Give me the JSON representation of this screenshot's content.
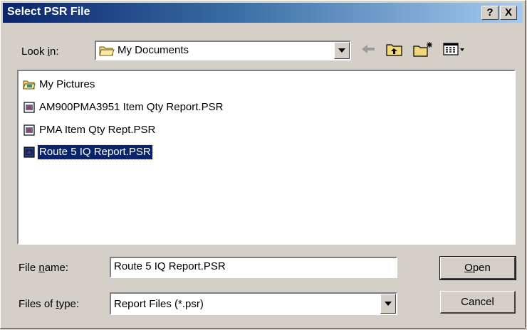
{
  "window": {
    "title": "Select PSR File",
    "help_label": "?",
    "close_label": "X"
  },
  "look_in": {
    "label_prefix": "Look ",
    "label_accel": "i",
    "label_suffix": "n:",
    "value": "My Documents"
  },
  "toolbar": {
    "back_icon": "back-arrow-icon",
    "up_icon": "up-folder-icon",
    "new_folder_icon": "new-folder-icon",
    "view_icon": "view-menu-icon"
  },
  "files": [
    {
      "name": "My Pictures",
      "icon": "folder-icon"
    },
    {
      "name": "AM900PMA3951 Item Qty Report.PSR",
      "icon": "psr-file-icon"
    },
    {
      "name": "PMA Item Qty Rept.PSR",
      "icon": "psr-file-icon"
    },
    {
      "name": "Route 5 IQ Report.PSR",
      "icon": "psr-file-icon",
      "selected": true
    }
  ],
  "file_name": {
    "label_prefix": "File ",
    "label_accel": "n",
    "label_suffix": "ame:",
    "value": "Route 5 IQ Report.PSR"
  },
  "file_type": {
    "label_prefix": "Files of ",
    "label_accel": "t",
    "label_suffix": "ype:",
    "value": "Report Files (*.psr)"
  },
  "buttons": {
    "open_accel": "O",
    "open_rest": "pen",
    "cancel": "Cancel"
  },
  "colors": {
    "title_start": "#0a246a",
    "title_end": "#a6caf0",
    "selection": "#0a246a",
    "face": "#d4d0c8"
  }
}
